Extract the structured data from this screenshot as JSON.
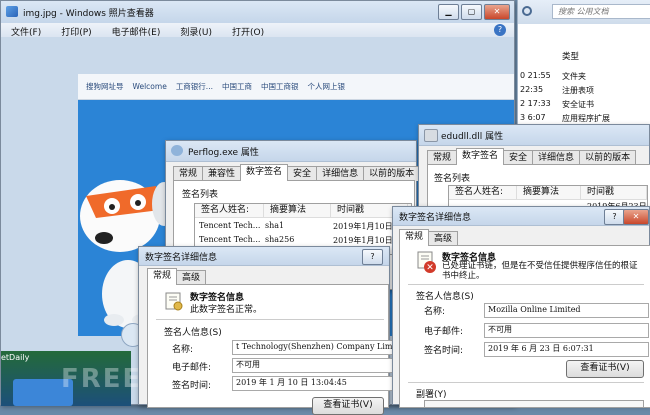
{
  "viewer": {
    "title": "img.jpg - Windows 照片查看器",
    "menu": [
      "文件(F)",
      "打印(P)",
      "电子邮件(E)",
      "刻录(U)",
      "打开(O)"
    ],
    "help_icon": "help-icon",
    "bookmarks": [
      "搜狗网址导",
      "Welcome",
      "工商银行...",
      "中国工商",
      "中国工商银",
      "个人网上银"
    ]
  },
  "explorer": {
    "search_placeholder": "搜索 公用文档",
    "column_header": "类型",
    "rows": [
      {
        "time": "0 21:55",
        "type": "文件夹"
      },
      {
        "time": "22:35",
        "type": "注册表项"
      },
      {
        "time": "2 17:33",
        "type": "安全证书"
      },
      {
        "time": "3 6:07",
        "type": "应用程序扩展"
      }
    ]
  },
  "perflog": {
    "title": "Perflog.exe 属性",
    "tabs": [
      "常规",
      "兼容性",
      "数字签名",
      "安全",
      "详细信息",
      "以前的版本"
    ],
    "active_tab": 2,
    "list_label": "签名列表",
    "columns": [
      "签名人姓名:",
      "摘要算法",
      "时间戳"
    ],
    "rows": [
      {
        "name": "Tencent Tech...",
        "algo": "sha1",
        "time": "2019年1月10日"
      },
      {
        "name": "Tencent Tech...",
        "algo": "sha256",
        "time": "2019年1月10日"
      }
    ]
  },
  "edudll": {
    "title": "edudll.dll 属性",
    "tabs": [
      "常规",
      "数字签名",
      "安全",
      "详细信息",
      "以前的版本"
    ],
    "active_tab": 1,
    "list_label": "签名列表",
    "columns": [
      "签名人姓名:",
      "摘要算法",
      "时间戳"
    ],
    "row_partial": "2019年6月23日"
  },
  "detail_left": {
    "title": "数字签名详细信息",
    "help": "?",
    "tabs": [
      "常规",
      "高级"
    ],
    "info_title": "数字签名信息",
    "info_text": "此数字签名正常。",
    "signer_section": "签名人信息(S)",
    "name_label": "名称:",
    "name_value": "t Technology(Shenzhen) Company Limited",
    "email_label": "电子邮件:",
    "email_value": "不可用",
    "time_label": "签名时间:",
    "time_value": "2019  年  1  月  10  日  13:04:45",
    "view_cert": "查看证书(V)"
  },
  "detail_right": {
    "title": "数字签名详细信息",
    "help": "?",
    "tabs": [
      "常规",
      "高级"
    ],
    "info_title": "数字签名信息",
    "info_text": "已处理证书链，但是在不受信任提供程序信任的根证书中终止。",
    "signer_section": "签名人信息(S)",
    "name_label": "名称:",
    "name_value": "Mozilla Online Limited",
    "email_label": "电子邮件:",
    "email_value": "不可用",
    "time_label": "签名时间:",
    "time_value": "2019  年  6  月  23  日  6:07:31",
    "view_cert": "查看证书(V)",
    "countersign_section": "副署(Y)"
  },
  "desktop": {
    "icon_label": "etDaily",
    "watermark": "FREEBUF"
  },
  "colors": {
    "titlebar": "#c5d6ea",
    "viewer_bg": "#c9d9ea",
    "close": "#c9472b",
    "banner": "#2b84d6",
    "warning": "#d23a2a"
  }
}
